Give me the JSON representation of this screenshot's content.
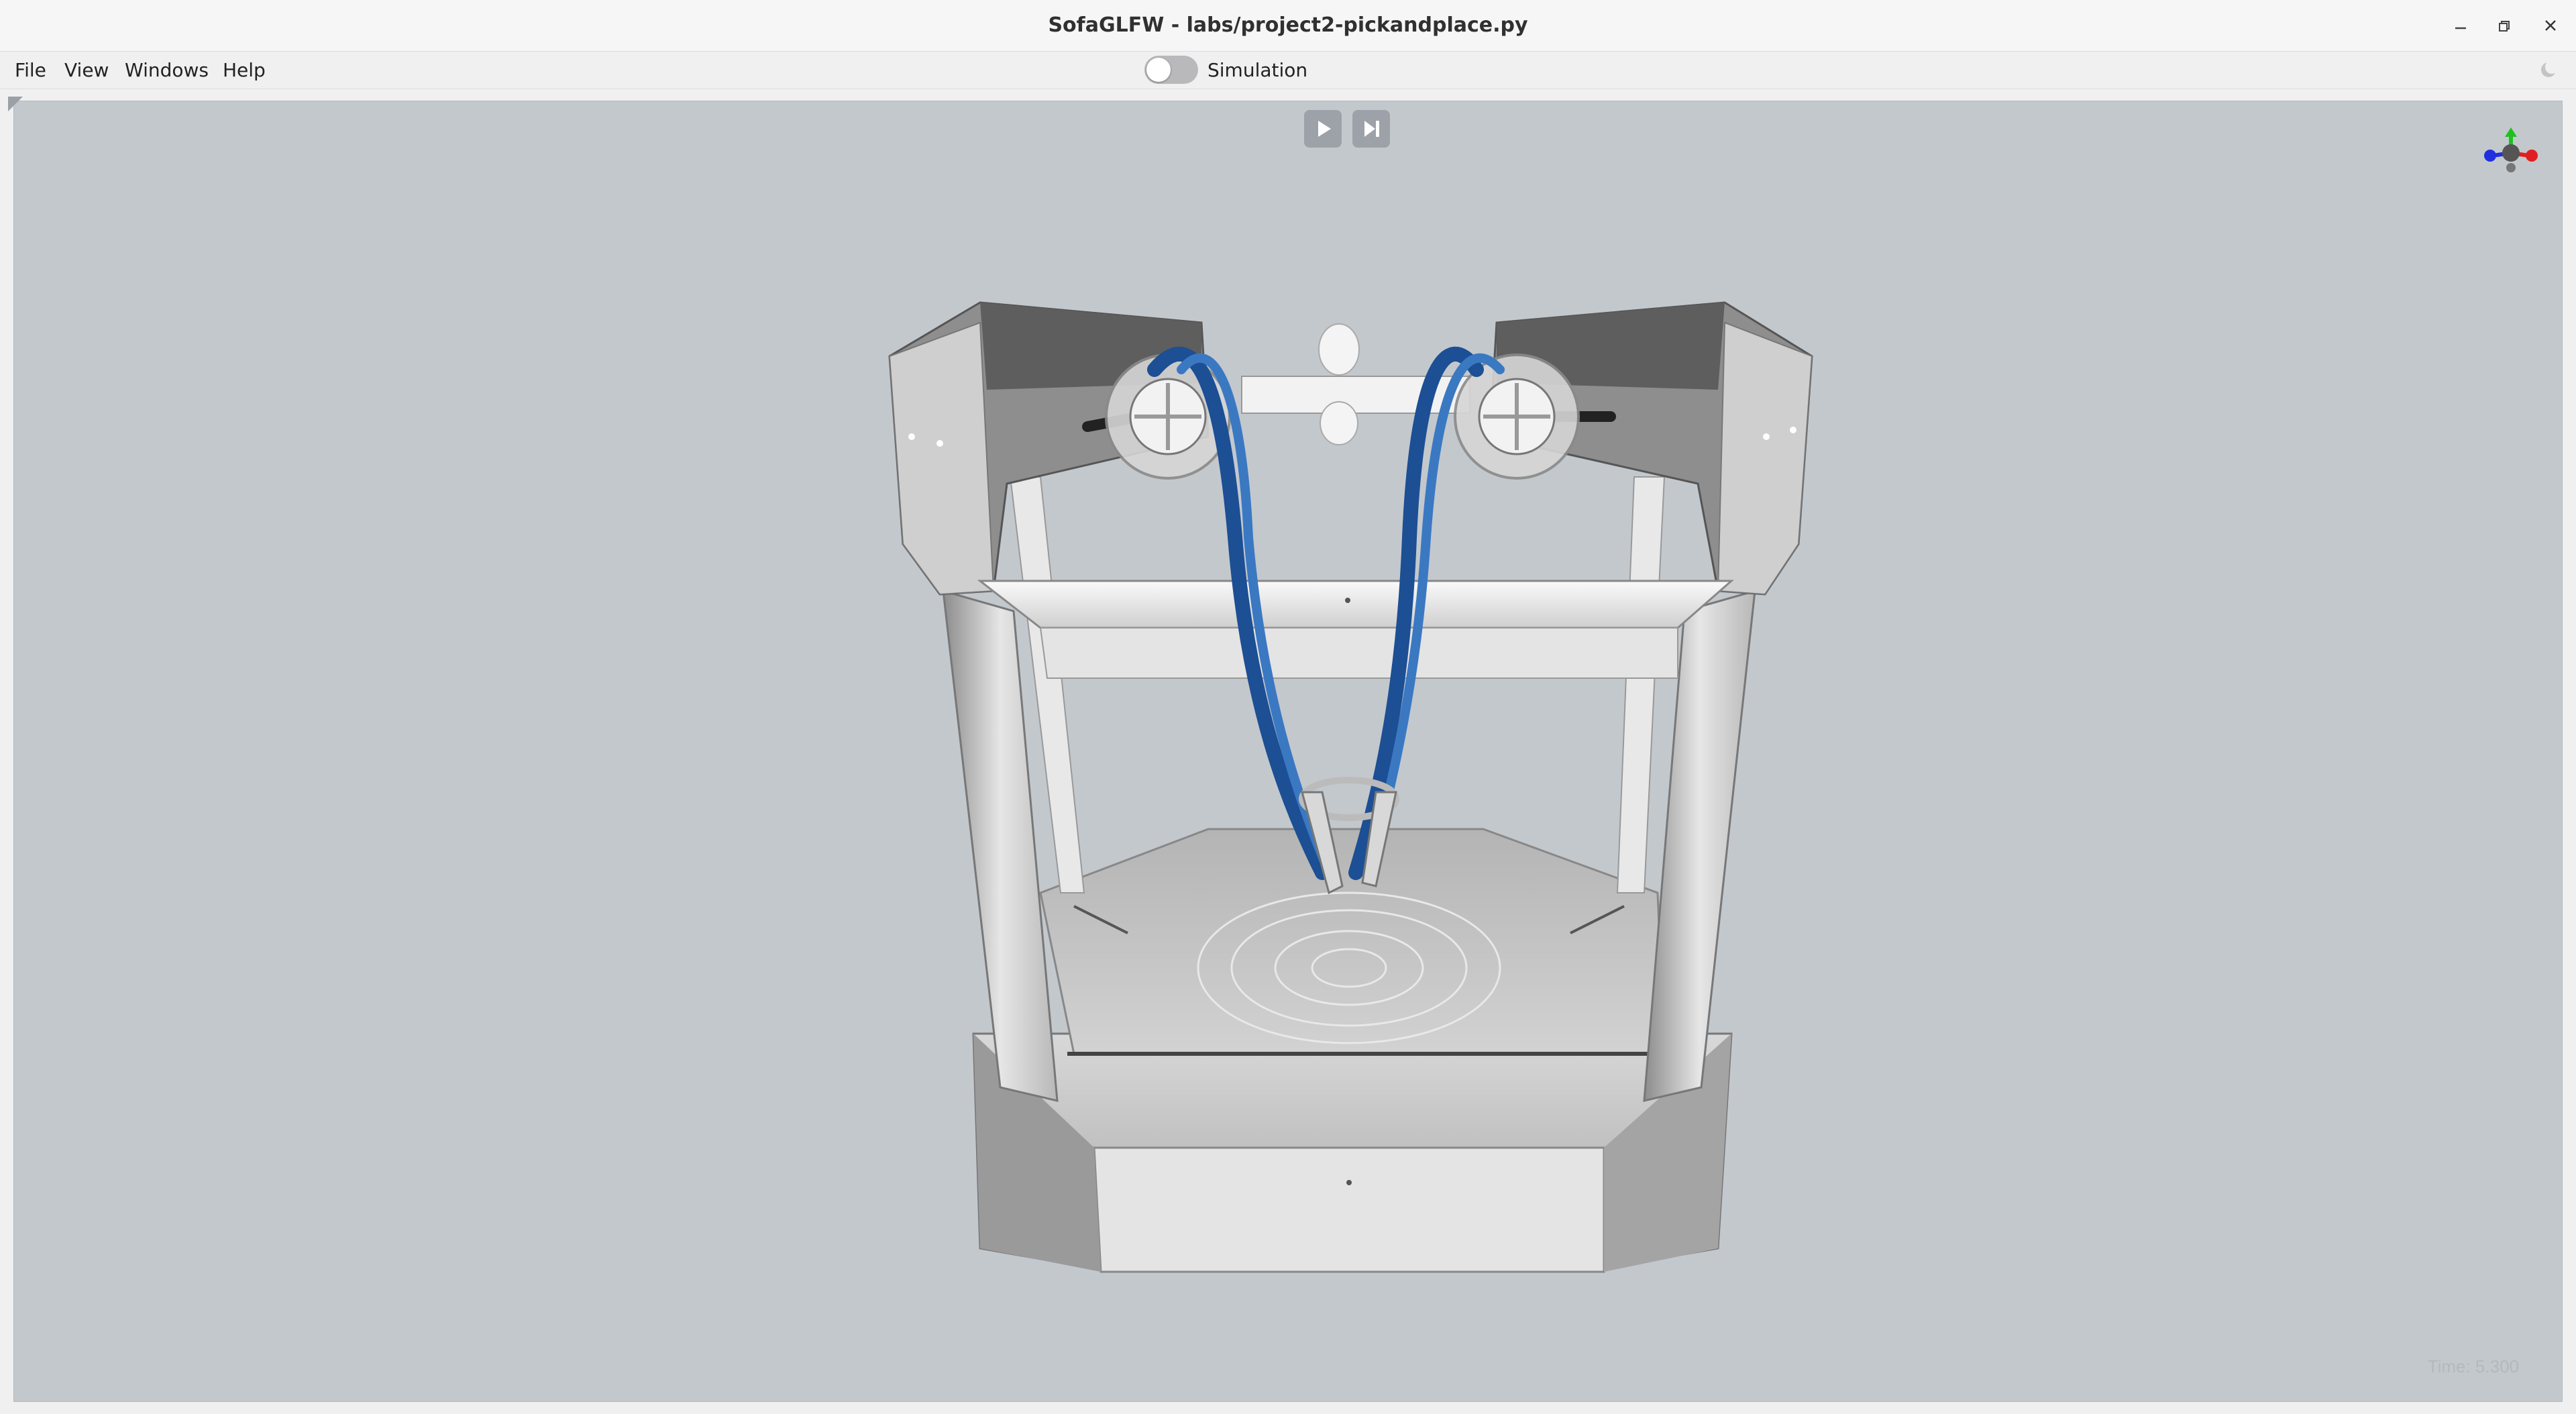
{
  "window": {
    "title": "SofaGLFW - labs/project2-pickandplace.py",
    "controls": {
      "minimize_icon": "minimize-icon",
      "restore_icon": "restore-icon",
      "close_icon": "close-icon"
    }
  },
  "menu": {
    "items": [
      {
        "label": "File"
      },
      {
        "label": "View"
      },
      {
        "label": "Windows"
      },
      {
        "label": "Help"
      }
    ]
  },
  "simulation": {
    "label": "Simulation",
    "enabled": false
  },
  "theme": {
    "icon": "moon-icon"
  },
  "playback": {
    "play_icon": "play-icon",
    "step_icon": "step-forward-icon"
  },
  "viewport": {
    "time_text": "Time: 5.300",
    "background_color": "#c3c8cd",
    "axis_gizmo_colors": {
      "x": "#e02020",
      "y": "#20c020",
      "z": "#2030e0"
    },
    "scene_object": "delta-robot-gripper-3d-model"
  }
}
